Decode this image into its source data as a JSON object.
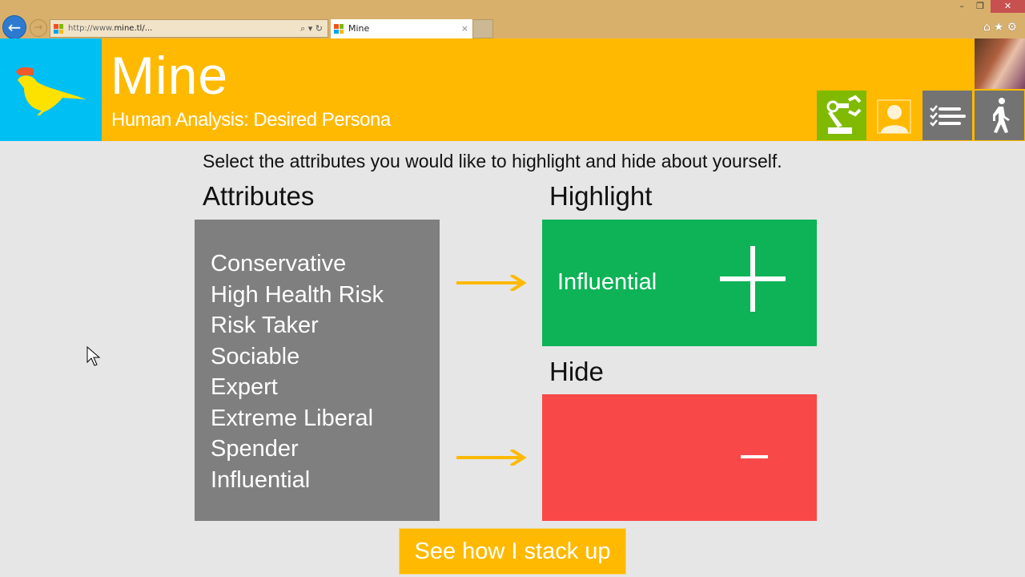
{
  "browser": {
    "url_prefix": "http://www.",
    "url_domain": "mine.tl/...",
    "tab_title": "Mine",
    "tab_close": "×",
    "back": "←",
    "forward": "→",
    "search_tools": "⌕ ▾ ↻",
    "minimize": "–",
    "restore": "❐",
    "close": "✕",
    "right_icons": "⌂★⚙"
  },
  "header": {
    "title": "Mine",
    "subtitle": "Human Analysis: Desired Persona"
  },
  "nav_icons": [
    "robot-arm-icon",
    "profile-icon",
    "checklist-icon",
    "walking-person-icon"
  ],
  "main": {
    "instruction": "Select the attributes you would like to highlight and hide about yourself.",
    "attributes_label": "Attributes",
    "attributes": [
      "Conservative",
      "High Health Risk",
      "Risk Taker",
      "Sociable",
      "Expert",
      "Extreme Liberal",
      "Spender",
      "Influential"
    ],
    "highlight_label": "Highlight",
    "highlight_items": [
      "Influential"
    ],
    "hide_label": "Hide",
    "hide_items": [],
    "button": "See how I stack up"
  },
  "colors": {
    "accent": "#ffb900",
    "logo_bg": "#00bff3",
    "highlight": "#0db356",
    "hide": "#f94848",
    "attributes_bg": "#7f7f7f"
  }
}
